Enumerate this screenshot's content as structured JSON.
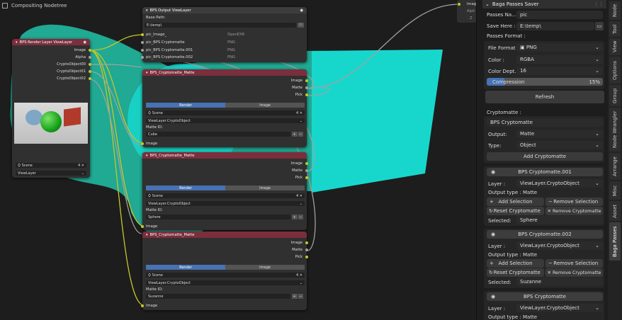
{
  "editor": {
    "title": "Compositing Nodetree"
  },
  "render_layer": {
    "title": "BPS Render Layer ViewLayer",
    "outputs": [
      "Image",
      "Alpha",
      "CryptoObject00",
      "CryptoObject01",
      "CryptoObject02"
    ],
    "scene": "Scene",
    "scene_users": "4",
    "view_layer": "ViewLayer"
  },
  "output_node": {
    "title": "BPS Output ViewLayer",
    "base_path_label": "Base Path:",
    "base_path": "E:\\temp\\",
    "inputs": [
      {
        "name": "pic_Image_",
        "fmt": "OpenEXR"
      },
      {
        "name": "pic_BPS Cryptomatte",
        "fmt": "PNG"
      },
      {
        "name": "pic_BPS Cryptomatte.001",
        "fmt": "PNG"
      },
      {
        "name": "pic_BPS Cryptomatte.002",
        "fmt": "PNG"
      }
    ]
  },
  "matte_nodes": [
    {
      "title": "BPS_Cryptomatte_Matte",
      "outputs": [
        "Image",
        "Matte",
        "Pick"
      ],
      "tab_render": "Render",
      "tab_image": "Image",
      "scene": "Scene",
      "scene_users": "4",
      "layer": "ViewLayer.CryptoObject",
      "matte_id_label": "Matte ID:",
      "matte_id": "Cube",
      "input": "Image"
    },
    {
      "title": "BPS_Cryptomatte_Matte",
      "outputs": [
        "Image",
        "Matte",
        "Pick"
      ],
      "tab_render": "Render",
      "tab_image": "Image",
      "scene": "Scene",
      "scene_users": "4",
      "layer": "ViewLayer.CryptoObject",
      "matte_id_label": "Matte ID:",
      "matte_id": "Sphere",
      "input": "Image"
    },
    {
      "title": "BPS_Cryptomatte_Matte",
      "outputs": [
        "Image",
        "Matte",
        "Pick"
      ],
      "tab_render": "Render",
      "tab_image": "Image",
      "scene": "Scene",
      "scene_users": "4",
      "layer": "ViewLayer.CryptoObject",
      "matte_id_label": "Matte ID:",
      "matte_id": "Suzanne",
      "input": "Image"
    }
  ],
  "viewer": {
    "outputs": [
      "Image",
      "Alph",
      "Z"
    ]
  },
  "panel": {
    "title": "Baga Passes Saver",
    "passes_name_label": "Passes Na...",
    "passes_name": "pic",
    "save_here_label": "Save Here :",
    "save_here": "E:\\temp\\",
    "passes_format_label": "Passes Format :",
    "file_format_label": "File Format :",
    "file_format": "PNG",
    "color_label": "Color :",
    "color": "RGBA",
    "color_depth_label": "Color Dept...",
    "color_depth": "16",
    "compression_label": "Compression",
    "compression": "15%",
    "refresh": "Refresh",
    "cryptomatte_label": "Cryptomatte :",
    "crypto_name": "BPS Cryptomatte",
    "output_label": "Output:",
    "output": "Matte",
    "type_label": "Type:",
    "type": "Object",
    "add_crypto": "Add Cryptomatte",
    "sections": [
      {
        "name": "BPS Cryptomatte.001",
        "layer_label": "Layer :",
        "layer": "ViewLayer.CryptoObject",
        "output_type": "Output type : Matte",
        "add_sel": "Add Selection",
        "rem_sel": "Remove Selection",
        "reset": "Reset Cryptomatte",
        "remove": "Remove Cryptomatte",
        "selected_label": "Selected:",
        "selected": "Sphere"
      },
      {
        "name": "BPS Cryptomatte.002",
        "layer_label": "Layer :",
        "layer": "ViewLayer.CryptoObject",
        "output_type": "Output type : Matte",
        "add_sel": "Add Selection",
        "rem_sel": "Remove Selection",
        "reset": "Reset Cryptomatte",
        "remove": "Remove Cryptomatte",
        "selected_label": "Selected:",
        "selected": "Suzanne"
      },
      {
        "name": "BPS Cryptomatte",
        "layer_label": "Layer :",
        "layer": "ViewLayer.CryptoObject",
        "output_type": "Output type : Matte"
      }
    ]
  },
  "tabs": [
    "Node",
    "Tool",
    "View",
    "Options",
    "Group",
    "Node Wrangler",
    "Arrange",
    "Misc",
    "Asset",
    "Baga Passes"
  ],
  "colors": {
    "node_header_red": "#7b2e3c",
    "node_header_gray": "#3d3d3d",
    "socket_yellow": "#c7c729",
    "socket_gray": "#a1a1a1",
    "tab_blue": "#4772b3",
    "backdrop_teal": "#17d7cd",
    "backdrop_green": "#20a993"
  }
}
